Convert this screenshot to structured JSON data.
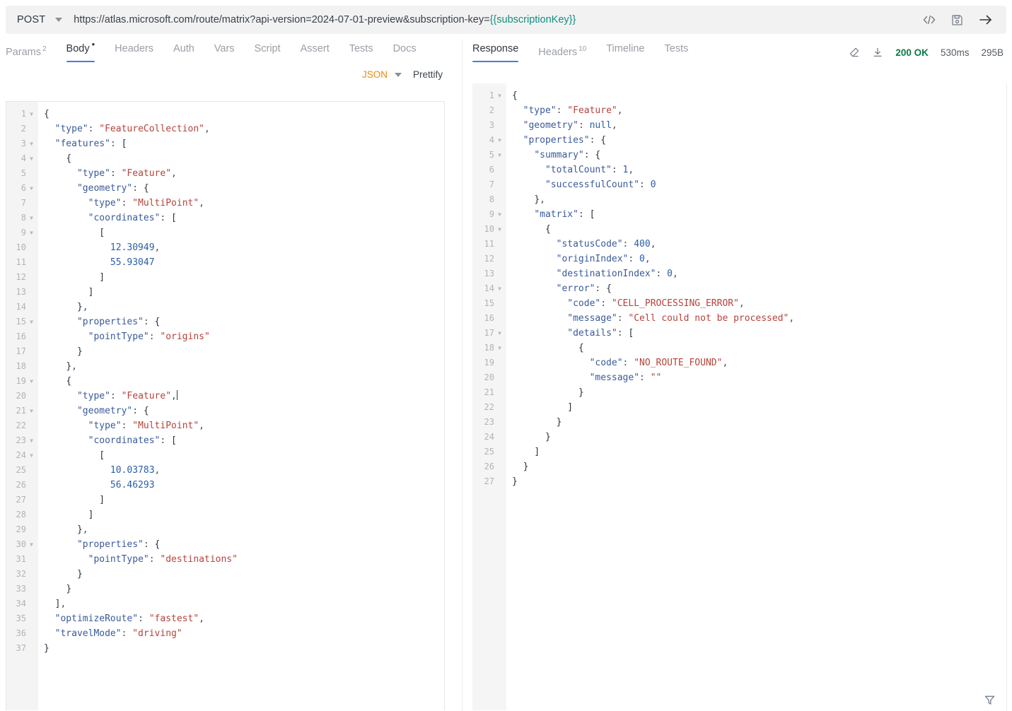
{
  "urlbar": {
    "method": "POST",
    "url_prefix": "https://atlas.microsoft.com/route/matrix?api-version=2024-07-01-preview&subscription-key=",
    "url_variable": "{{subscriptionKey}}",
    "icons": [
      "code-icon",
      "save-icon",
      "send-arrow-icon"
    ]
  },
  "request": {
    "tabs": [
      {
        "label": "Params",
        "badge": "2",
        "active": false
      },
      {
        "label": "Body",
        "badge": "•",
        "active": true
      },
      {
        "label": "Headers",
        "badge": "",
        "active": false
      },
      {
        "label": "Auth",
        "badge": "",
        "active": false
      },
      {
        "label": "Vars",
        "badge": "",
        "active": false
      },
      {
        "label": "Script",
        "badge": "",
        "active": false
      },
      {
        "label": "Assert",
        "badge": "",
        "active": false
      },
      {
        "label": "Tests",
        "badge": "",
        "active": false
      },
      {
        "label": "Docs",
        "badge": "",
        "active": false
      }
    ],
    "body_format": "JSON",
    "prettify_label": "Prettify",
    "line_count": 37,
    "folds": [
      1,
      3,
      4,
      6,
      8,
      9,
      15,
      19,
      21,
      23,
      24,
      30
    ],
    "code_lines": [
      [
        [
          "b",
          "{"
        ]
      ],
      [
        [
          "p",
          "  "
        ],
        [
          "k",
          "\"type\""
        ],
        [
          "p",
          ": "
        ],
        [
          "s",
          "\"FeatureCollection\""
        ],
        [
          "p",
          ","
        ]
      ],
      [
        [
          "p",
          "  "
        ],
        [
          "k",
          "\"features\""
        ],
        [
          "p",
          ": "
        ],
        [
          "b",
          "["
        ]
      ],
      [
        [
          "p",
          "    "
        ],
        [
          "b",
          "{"
        ]
      ],
      [
        [
          "p",
          "      "
        ],
        [
          "k",
          "\"type\""
        ],
        [
          "p",
          ": "
        ],
        [
          "s",
          "\"Feature\""
        ],
        [
          "p",
          ","
        ]
      ],
      [
        [
          "p",
          "      "
        ],
        [
          "k",
          "\"geometry\""
        ],
        [
          "p",
          ": "
        ],
        [
          "b",
          "{"
        ]
      ],
      [
        [
          "p",
          "        "
        ],
        [
          "k",
          "\"type\""
        ],
        [
          "p",
          ": "
        ],
        [
          "s",
          "\"MultiPoint\""
        ],
        [
          "p",
          ","
        ]
      ],
      [
        [
          "p",
          "        "
        ],
        [
          "k",
          "\"coordinates\""
        ],
        [
          "p",
          ": "
        ],
        [
          "b",
          "["
        ]
      ],
      [
        [
          "p",
          "          "
        ],
        [
          "b",
          "["
        ]
      ],
      [
        [
          "p",
          "            "
        ],
        [
          "n",
          "12.30949"
        ],
        [
          "p",
          ","
        ]
      ],
      [
        [
          "p",
          "            "
        ],
        [
          "n",
          "55.93047"
        ]
      ],
      [
        [
          "p",
          "          "
        ],
        [
          "b",
          "]"
        ]
      ],
      [
        [
          "p",
          "        "
        ],
        [
          "b",
          "]"
        ]
      ],
      [
        [
          "p",
          "      "
        ],
        [
          "b",
          "}"
        ],
        [
          "p",
          ","
        ]
      ],
      [
        [
          "p",
          "      "
        ],
        [
          "k",
          "\"properties\""
        ],
        [
          "p",
          ": "
        ],
        [
          "b",
          "{"
        ]
      ],
      [
        [
          "p",
          "        "
        ],
        [
          "k",
          "\"pointType\""
        ],
        [
          "p",
          ": "
        ],
        [
          "s",
          "\"origins\""
        ]
      ],
      [
        [
          "p",
          "      "
        ],
        [
          "b",
          "}"
        ]
      ],
      [
        [
          "p",
          "    "
        ],
        [
          "b",
          "}"
        ],
        [
          "p",
          ","
        ]
      ],
      [
        [
          "p",
          "    "
        ],
        [
          "b",
          "{"
        ]
      ],
      [
        [
          "p",
          "      "
        ],
        [
          "k",
          "\"type\""
        ],
        [
          "p",
          ": "
        ],
        [
          "s",
          "\"Feature\""
        ],
        [
          "p",
          ","
        ],
        [
          "caret",
          ""
        ]
      ],
      [
        [
          "p",
          "      "
        ],
        [
          "k",
          "\"geometry\""
        ],
        [
          "p",
          ": "
        ],
        [
          "b",
          "{"
        ]
      ],
      [
        [
          "p",
          "        "
        ],
        [
          "k",
          "\"type\""
        ],
        [
          "p",
          ": "
        ],
        [
          "s",
          "\"MultiPoint\""
        ],
        [
          "p",
          ","
        ]
      ],
      [
        [
          "p",
          "        "
        ],
        [
          "k",
          "\"coordinates\""
        ],
        [
          "p",
          ": "
        ],
        [
          "b",
          "["
        ]
      ],
      [
        [
          "p",
          "          "
        ],
        [
          "b",
          "["
        ]
      ],
      [
        [
          "p",
          "            "
        ],
        [
          "n",
          "10.03783"
        ],
        [
          "p",
          ","
        ]
      ],
      [
        [
          "p",
          "            "
        ],
        [
          "n",
          "56.46293"
        ]
      ],
      [
        [
          "p",
          "          "
        ],
        [
          "b",
          "]"
        ]
      ],
      [
        [
          "p",
          "        "
        ],
        [
          "b",
          "]"
        ]
      ],
      [
        [
          "p",
          "      "
        ],
        [
          "b",
          "}"
        ],
        [
          "p",
          ","
        ]
      ],
      [
        [
          "p",
          "      "
        ],
        [
          "k",
          "\"properties\""
        ],
        [
          "p",
          ": "
        ],
        [
          "b",
          "{"
        ]
      ],
      [
        [
          "p",
          "        "
        ],
        [
          "k",
          "\"pointType\""
        ],
        [
          "p",
          ": "
        ],
        [
          "s",
          "\"destinations\""
        ]
      ],
      [
        [
          "p",
          "      "
        ],
        [
          "b",
          "}"
        ]
      ],
      [
        [
          "p",
          "    "
        ],
        [
          "b",
          "}"
        ]
      ],
      [
        [
          "p",
          "  "
        ],
        [
          "b",
          "]"
        ],
        [
          "p",
          ","
        ]
      ],
      [
        [
          "p",
          "  "
        ],
        [
          "k",
          "\"optimizeRoute\""
        ],
        [
          "p",
          ": "
        ],
        [
          "s",
          "\"fastest\""
        ],
        [
          "p",
          ","
        ]
      ],
      [
        [
          "p",
          "  "
        ],
        [
          "k",
          "\"travelMode\""
        ],
        [
          "p",
          ": "
        ],
        [
          "s",
          "\"driving\""
        ]
      ],
      [
        [
          "b",
          "}"
        ]
      ]
    ]
  },
  "response": {
    "tabs": [
      {
        "label": "Response",
        "badge": "",
        "active": true
      },
      {
        "label": "Headers",
        "badge": "10",
        "active": false
      },
      {
        "label": "Timeline",
        "badge": "",
        "active": false
      },
      {
        "label": "Tests",
        "badge": "",
        "active": false
      }
    ],
    "meta": {
      "status": "200 OK",
      "time": "530ms",
      "size": "295B",
      "status_color": "#0a7a45"
    },
    "icons": [
      "clear-icon",
      "download-icon",
      "filter-icon"
    ],
    "line_count": 27,
    "folds": [
      1,
      4,
      5,
      9,
      10,
      14,
      17,
      18
    ],
    "code_lines": [
      [
        [
          "b",
          "{"
        ]
      ],
      [
        [
          "p",
          "  "
        ],
        [
          "k",
          "\"type\""
        ],
        [
          "p",
          ": "
        ],
        [
          "s",
          "\"Feature\""
        ],
        [
          "p",
          ","
        ]
      ],
      [
        [
          "p",
          "  "
        ],
        [
          "k",
          "\"geometry\""
        ],
        [
          "p",
          ": "
        ],
        [
          "nl",
          "null"
        ],
        [
          "p",
          ","
        ]
      ],
      [
        [
          "p",
          "  "
        ],
        [
          "k",
          "\"properties\""
        ],
        [
          "p",
          ": "
        ],
        [
          "b",
          "{"
        ]
      ],
      [
        [
          "p",
          "    "
        ],
        [
          "k",
          "\"summary\""
        ],
        [
          "p",
          ": "
        ],
        [
          "b",
          "{"
        ]
      ],
      [
        [
          "p",
          "      "
        ],
        [
          "k",
          "\"totalCount\""
        ],
        [
          "p",
          ": "
        ],
        [
          "n",
          "1"
        ],
        [
          "p",
          ","
        ]
      ],
      [
        [
          "p",
          "      "
        ],
        [
          "k",
          "\"successfulCount\""
        ],
        [
          "p",
          ": "
        ],
        [
          "n",
          "0"
        ]
      ],
      [
        [
          "p",
          "    "
        ],
        [
          "b",
          "}"
        ],
        [
          "p",
          ","
        ]
      ],
      [
        [
          "p",
          "    "
        ],
        [
          "k",
          "\"matrix\""
        ],
        [
          "p",
          ": "
        ],
        [
          "b",
          "["
        ]
      ],
      [
        [
          "p",
          "      "
        ],
        [
          "b",
          "{"
        ]
      ],
      [
        [
          "p",
          "        "
        ],
        [
          "k",
          "\"statusCode\""
        ],
        [
          "p",
          ": "
        ],
        [
          "n",
          "400"
        ],
        [
          "p",
          ","
        ]
      ],
      [
        [
          "p",
          "        "
        ],
        [
          "k",
          "\"originIndex\""
        ],
        [
          "p",
          ": "
        ],
        [
          "n",
          "0"
        ],
        [
          "p",
          ","
        ]
      ],
      [
        [
          "p",
          "        "
        ],
        [
          "k",
          "\"destinationIndex\""
        ],
        [
          "p",
          ": "
        ],
        [
          "n",
          "0"
        ],
        [
          "p",
          ","
        ]
      ],
      [
        [
          "p",
          "        "
        ],
        [
          "k",
          "\"error\""
        ],
        [
          "p",
          ": "
        ],
        [
          "b",
          "{"
        ]
      ],
      [
        [
          "p",
          "          "
        ],
        [
          "k",
          "\"code\""
        ],
        [
          "p",
          ": "
        ],
        [
          "s",
          "\"CELL_PROCESSING_ERROR\""
        ],
        [
          "p",
          ","
        ]
      ],
      [
        [
          "p",
          "          "
        ],
        [
          "k",
          "\"message\""
        ],
        [
          "p",
          ": "
        ],
        [
          "s",
          "\"Cell could not be processed\""
        ],
        [
          "p",
          ","
        ]
      ],
      [
        [
          "p",
          "          "
        ],
        [
          "k",
          "\"details\""
        ],
        [
          "p",
          ": "
        ],
        [
          "b",
          "["
        ]
      ],
      [
        [
          "p",
          "            "
        ],
        [
          "b",
          "{"
        ]
      ],
      [
        [
          "p",
          "              "
        ],
        [
          "k",
          "\"code\""
        ],
        [
          "p",
          ": "
        ],
        [
          "s",
          "\"NO_ROUTE_FOUND\""
        ],
        [
          "p",
          ","
        ]
      ],
      [
        [
          "p",
          "              "
        ],
        [
          "k",
          "\"message\""
        ],
        [
          "p",
          ": "
        ],
        [
          "s",
          "\"\""
        ]
      ],
      [
        [
          "p",
          "            "
        ],
        [
          "b",
          "}"
        ]
      ],
      [
        [
          "p",
          "          "
        ],
        [
          "b",
          "]"
        ]
      ],
      [
        [
          "p",
          "        "
        ],
        [
          "b",
          "}"
        ]
      ],
      [
        [
          "p",
          "      "
        ],
        [
          "b",
          "}"
        ]
      ],
      [
        [
          "p",
          "    "
        ],
        [
          "b",
          "]"
        ]
      ],
      [
        [
          "p",
          "  "
        ],
        [
          "b",
          "}"
        ]
      ],
      [
        [
          "b",
          "}"
        ]
      ]
    ]
  }
}
